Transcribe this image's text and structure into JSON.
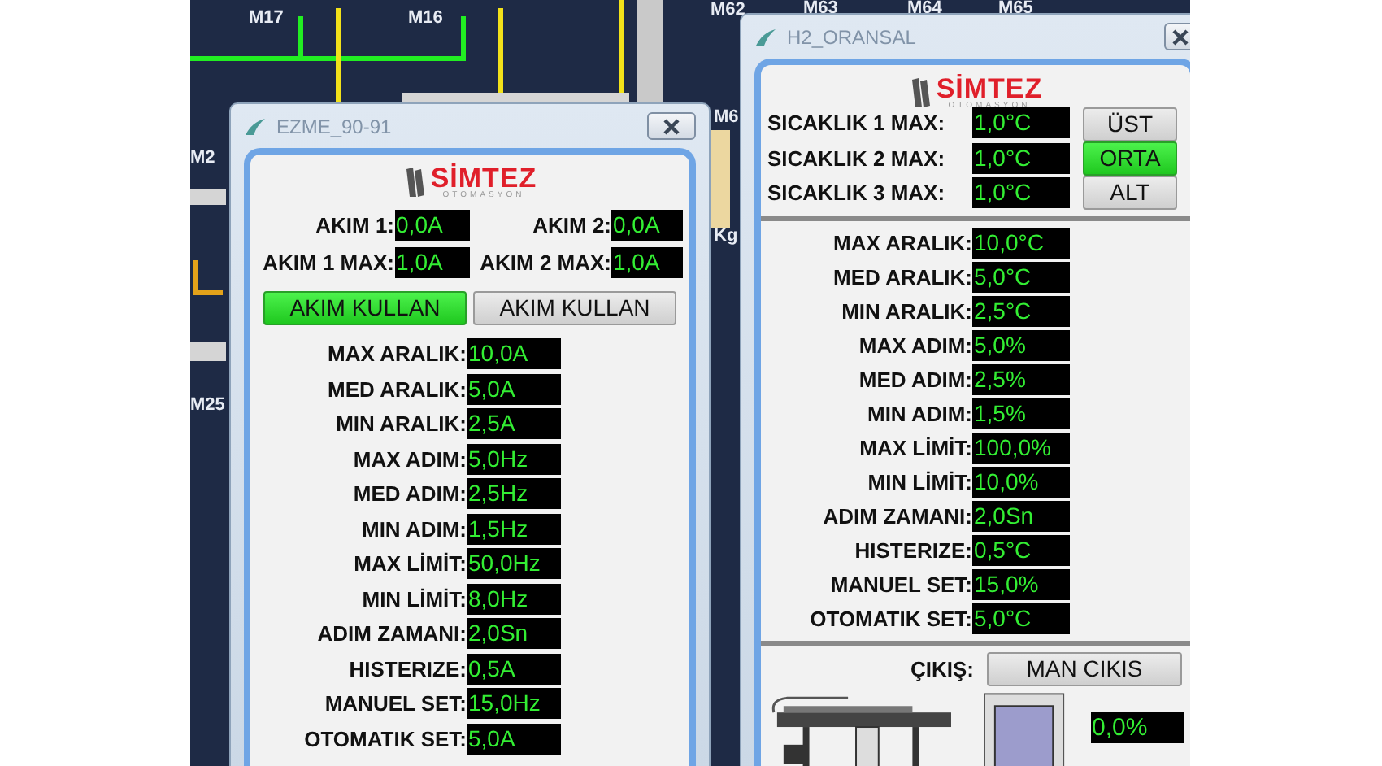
{
  "background": {
    "labels": [
      {
        "text": "M17"
      },
      {
        "text": "M16"
      },
      {
        "text": "M62"
      },
      {
        "text": "M63"
      },
      {
        "text": "M64"
      },
      {
        "text": "M65"
      },
      {
        "text": "M2"
      },
      {
        "text": "M6"
      },
      {
        "text": "Kg"
      },
      {
        "text": "M25"
      }
    ]
  },
  "window_1": {
    "title": "EZME_90-91",
    "logo": {
      "name": "SİMTEZ",
      "subtitle": "OTOMASYON"
    },
    "currents": [
      {
        "label": "AKIM 1:",
        "value": "0,0A"
      },
      {
        "label": "AKIM 2:",
        "value": "0,0A"
      },
      {
        "label": "AKIM 1 MAX:",
        "value": "1,0A"
      },
      {
        "label": "AKIM 2 MAX:",
        "value": "1,0A"
      }
    ],
    "buttons": [
      {
        "label": "AKIM KULLAN",
        "selected": true
      },
      {
        "label": "AKIM KULLAN",
        "selected": false
      }
    ],
    "rows": [
      {
        "label": "MAX ARALIK:",
        "value": "10,0A"
      },
      {
        "label": "MED ARALIK:",
        "value": "5,0A"
      },
      {
        "label": "MIN ARALIK:",
        "value": "2,5A"
      },
      {
        "label": "MAX ADIM:",
        "value": "5,0Hz"
      },
      {
        "label": "MED ADIM:",
        "value": "2,5Hz"
      },
      {
        "label": "MIN ADIM:",
        "value": "1,5Hz"
      },
      {
        "label": "MAX LİMİT:",
        "value": "50,0Hz"
      },
      {
        "label": "MIN LİMİT:",
        "value": "8,0Hz"
      },
      {
        "label": "ADIM ZAMANI:",
        "value": "2,0Sn"
      },
      {
        "label": "HISTERIZE:",
        "value": "0,5A"
      },
      {
        "label": "MANUEL SET:",
        "value": "15,0Hz"
      },
      {
        "label": "OTOMATIK SET:",
        "value": "5,0A"
      }
    ]
  },
  "window_2": {
    "title": "H2_ORANSAL",
    "logo": {
      "name": "SİMTEZ",
      "subtitle": "OTOMASYON"
    },
    "temperatures": [
      {
        "label": "SICAKLIK 1 MAX:",
        "value": "1,0°C"
      },
      {
        "label": "SICAKLIK 2 MAX:",
        "value": "1,0°C"
      },
      {
        "label": "SICAKLIK 3 MAX:",
        "value": "1,0°C"
      }
    ],
    "zone_buttons": [
      {
        "label": "ÜST",
        "selected": false
      },
      {
        "label": "ORTA",
        "selected": true
      },
      {
        "label": "ALT",
        "selected": false
      }
    ],
    "rows": [
      {
        "label": "MAX ARALIK:",
        "value": "10,0°C"
      },
      {
        "label": "MED ARALIK:",
        "value": "5,0°C"
      },
      {
        "label": "MIN ARALIK:",
        "value": "2,5°C"
      },
      {
        "label": "MAX ADIM:",
        "value": "5,0%"
      },
      {
        "label": "MED ADIM:",
        "value": "2,5%"
      },
      {
        "label": "MIN ADIM:",
        "value": "1,5%"
      },
      {
        "label": "MAX LİMİT:",
        "value": "100,0%"
      },
      {
        "label": "MIN LİMİT:",
        "value": "10,0%"
      },
      {
        "label": "ADIM ZAMANI:",
        "value": "2,0Sn"
      },
      {
        "label": "HISTERIZE:",
        "value": "0,5°C"
      },
      {
        "label": "MANUEL SET:",
        "value": "15,0%"
      },
      {
        "label": "OTOMATIK SET:",
        "value": "5,0°C"
      }
    ],
    "output": {
      "label": "ÇIKIŞ:",
      "button": "MAN CIKIS",
      "reading": "0,0%"
    }
  }
}
